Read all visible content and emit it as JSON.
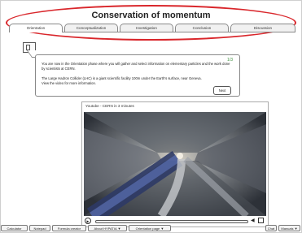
{
  "app": {
    "title": "Conservation of momentum"
  },
  "tabs": [
    {
      "label": "Orientation",
      "active": true
    },
    {
      "label": "Conceptualization",
      "active": false
    },
    {
      "label": "Investigation",
      "active": false
    },
    {
      "label": "Conclusion",
      "active": false
    },
    {
      "label": "Discussion",
      "active": false
    }
  ],
  "callout": {
    "page_indicator": "1/3",
    "paragraph1": "You are now in the Orientation phase where you will gather and select information on elementary particles and the work done by scientists at CERN.",
    "paragraph2": "The Large Hadron Collider (LHC) is a giant scientific facility 100m under the Earth's surface, near Geneva. View the video for more information.",
    "next_label": "Next"
  },
  "video": {
    "title": "Youtube - CERN in 3 minutes"
  },
  "toolbar": {
    "buttons": [
      "Calculator",
      "Notepad",
      "Formula creator",
      "About HYPATIA ▼",
      "Orientation page ▼"
    ],
    "right_buttons": [
      "Chat",
      "Manuals ▼"
    ]
  },
  "colors": {
    "highlight": "#d9262b",
    "accent": "#3a8c3a"
  },
  "icons": {
    "callout_icon": "phone-icon",
    "volume": "volume-icon",
    "fullscreen": "fullscreen-icon",
    "play": "play-icon"
  }
}
